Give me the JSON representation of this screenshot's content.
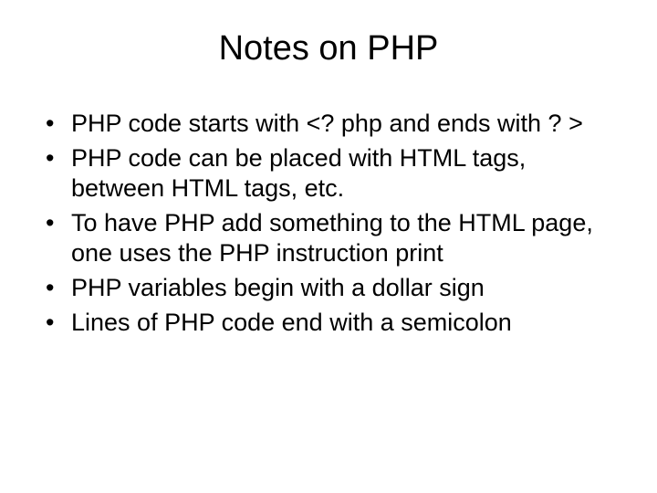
{
  "title": "Notes on PHP",
  "bullets": [
    "PHP code starts with <? php and ends with ? >",
    "PHP code can be placed with HTML tags, between HTML tags, etc.",
    "To have PHP add something to the HTML page, one uses the PHP instruction print",
    "PHP variables begin with a dollar sign",
    "Lines of PHP code end with a semicolon"
  ]
}
